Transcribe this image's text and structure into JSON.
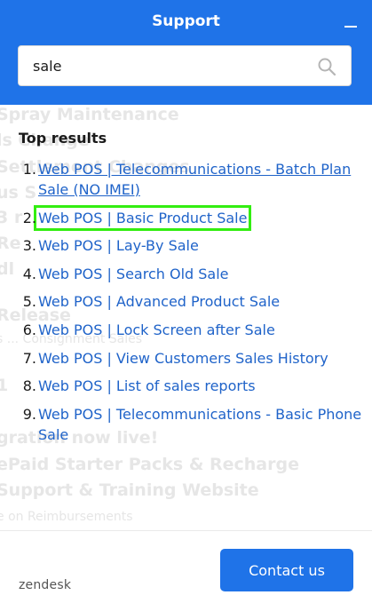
{
  "header": {
    "title": "Support",
    "minimize_icon": "minimize-icon"
  },
  "search": {
    "value": "sale",
    "icon": "search-icon"
  },
  "background_text": [
    "Spray Maintenance",
    "ls Change",
    "Settlement Changes",
    "us S",
    "3 r",
    "Re",
    "dl",
    "Release",
    "s ... Consignment Sales",
    "1",
    "gration now live!",
    "ePaid Starter Packs & Recharge",
    "Support & Training Website",
    "e on Reimbursements"
  ],
  "results": {
    "heading": "Top results",
    "items": [
      {
        "num": "1.",
        "label": "Web POS | Telecommunications - Batch Plan Sale (NO IMEI)"
      },
      {
        "num": "2.",
        "label": "Web POS | Basic Product Sale"
      },
      {
        "num": "3.",
        "label": "Web POS | Lay-By Sale"
      },
      {
        "num": "4.",
        "label": "Web POS | Search Old Sale"
      },
      {
        "num": "5.",
        "label": "Web POS | Advanced Product Sale"
      },
      {
        "num": "6.",
        "label": "Web POS | Lock Screen after Sale"
      },
      {
        "num": "7.",
        "label": "Web POS | View Customers Sales History"
      },
      {
        "num": "8.",
        "label": "Web POS | List of sales reports"
      },
      {
        "num": "9.",
        "label": "Web POS | Telecommunications - Basic Phone Sale"
      }
    ]
  },
  "footer": {
    "logo": "zendesk",
    "contact_label": "Contact us"
  },
  "colors": {
    "brand": "#1f73e8",
    "link": "#1f63c9",
    "highlight": "#33ee11"
  }
}
